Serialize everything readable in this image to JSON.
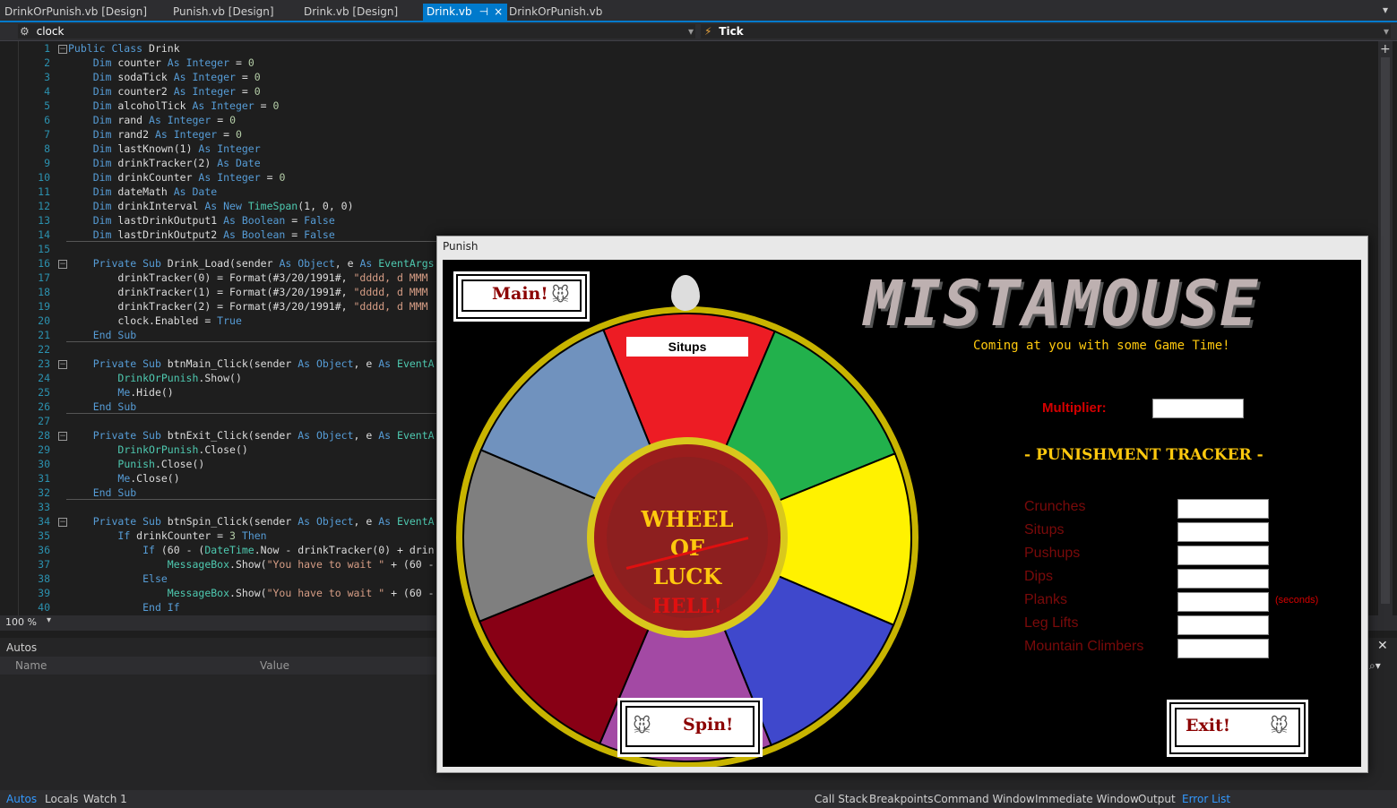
{
  "tabs": [
    {
      "label": "DrinkOrPunish.vb [Design]"
    },
    {
      "label": "Punish.vb [Design]"
    },
    {
      "label": "Drink.vb [Design]"
    },
    {
      "label": "Drink.vb",
      "active": true
    },
    {
      "label": "DrinkOrPunish.vb"
    }
  ],
  "nav": {
    "left": "clock",
    "right": "Tick"
  },
  "zoom": "100 %",
  "code_lines": [
    "1",
    "2",
    "3",
    "4",
    "5",
    "6",
    "7",
    "8",
    "9",
    "10",
    "11",
    "12",
    "13",
    "14",
    "15",
    "16",
    "17",
    "18",
    "19",
    "20",
    "21",
    "22",
    "23",
    "24",
    "25",
    "26",
    "27",
    "28",
    "29",
    "30",
    "31",
    "32",
    "33",
    "34",
    "35",
    "36",
    "37",
    "38",
    "39",
    "40"
  ],
  "autos": {
    "title": "Autos",
    "col_name": "Name",
    "col_value": "Value"
  },
  "bottom_tabs_left": [
    "Autos",
    "Locals",
    "Watch 1"
  ],
  "bottom_tabs_right": [
    "Call Stack",
    "Breakpoints",
    "Command Window",
    "Immediate Window",
    "Output",
    "Error List"
  ],
  "punish": {
    "window_title": "Punish",
    "main_btn": "Main!",
    "spin_btn": "Spin!",
    "exit_btn": "Exit!",
    "wheel_pointer_label": "Situps",
    "wheel_center": {
      "line1": "WHEEL",
      "line2": "OF",
      "line3": "LUCK",
      "line4": "HELL!"
    },
    "logo": "MISTAMOUSE",
    "tagline": "Coming at you with some Game Time!",
    "multiplier_label": "Multiplier:",
    "tracker_title": "- PUNISHMENT TRACKER -",
    "exercises": [
      "Crunches",
      "Situps",
      "Pushups",
      "Dips",
      "Planks",
      "Leg Lifts",
      "Mountain Climbers"
    ],
    "seconds_note": "(seconds)"
  },
  "colors": {
    "accent": "#007acc",
    "wheel_rim": "#c8b400",
    "slice_red": "#ed1c24",
    "slice_green": "#22b14c",
    "slice_yellow": "#fff200",
    "slice_blue": "#3f48cc",
    "slice_purple": "#a349a4",
    "slice_darkred": "#880015",
    "slice_gray": "#7f7f7f",
    "slice_steel": "#7092be"
  }
}
